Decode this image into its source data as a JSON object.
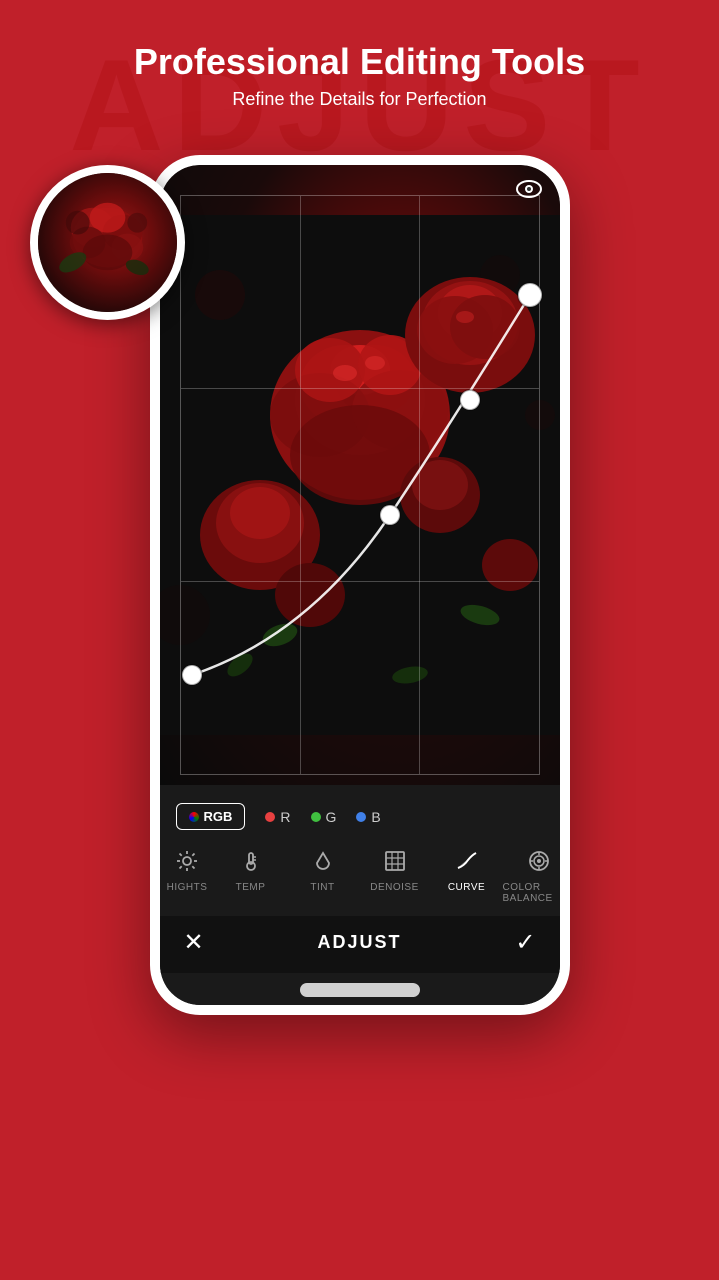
{
  "background": {
    "watermark": "ADJUST",
    "color": "#c0202a"
  },
  "header": {
    "title": "Professional Editing Tools",
    "subtitle": "Refine the Details for Perfection"
  },
  "phone": {
    "image_description": "Red roses on dark background",
    "eye_icon": "👁",
    "rgb_selector": {
      "active": "RGB",
      "channels": [
        {
          "label": "RGB",
          "dot": "rgb",
          "active": true
        },
        {
          "label": "R",
          "dot": "red"
        },
        {
          "label": "G",
          "dot": "green"
        },
        {
          "label": "B",
          "dot": "blue"
        }
      ]
    },
    "tools": [
      {
        "id": "highlights",
        "label": "HIGHTS",
        "icon": "☀"
      },
      {
        "id": "temp",
        "label": "TEMP",
        "icon": "🌡"
      },
      {
        "id": "tint",
        "label": "TINT",
        "icon": "💧"
      },
      {
        "id": "denoise",
        "label": "DENOISE",
        "icon": "▦"
      },
      {
        "id": "curve",
        "label": "CURVE",
        "icon": "📈",
        "active": true
      },
      {
        "id": "colorbalance",
        "label": "COLOR BALANCE",
        "icon": "⚙"
      }
    ],
    "action_bar": {
      "cancel": "✕",
      "title": "ADJUST",
      "confirm": "✓"
    }
  }
}
